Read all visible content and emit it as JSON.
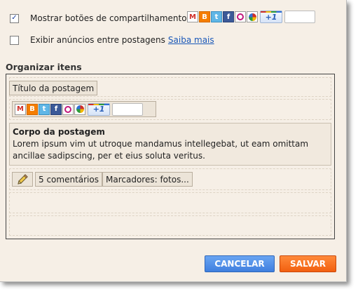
{
  "options": {
    "share": {
      "checked": true,
      "label": "Mostrar botões de compartilhamento"
    },
    "ads": {
      "checked": false,
      "label": "Exibir anúncios entre postagens",
      "link": "Saiba mais"
    }
  },
  "share_buttons": {
    "gmail": "M",
    "blogger": "B",
    "twitter": "t",
    "facebook": "f",
    "plusone": "+1"
  },
  "organize": {
    "title": "Organizar itens",
    "post_title": "Título da postagem",
    "post_body_heading": "Corpo da postagem",
    "post_body_text": "Lorem ipsum vim ut utroque mandamus intellegebat, ut eam omittam ancillae sadipscing, per et eius soluta veritus.",
    "comments": "5 comentários",
    "labels": "Marcadores: fotos..."
  },
  "footer": {
    "cancel": "CANCELAR",
    "save": "SALVAR"
  },
  "colors": {
    "panel_bg": "#f6efe6",
    "cancel_bg": "#4a88e4",
    "save_bg": "#f56a1a",
    "link": "#1a58b8"
  }
}
